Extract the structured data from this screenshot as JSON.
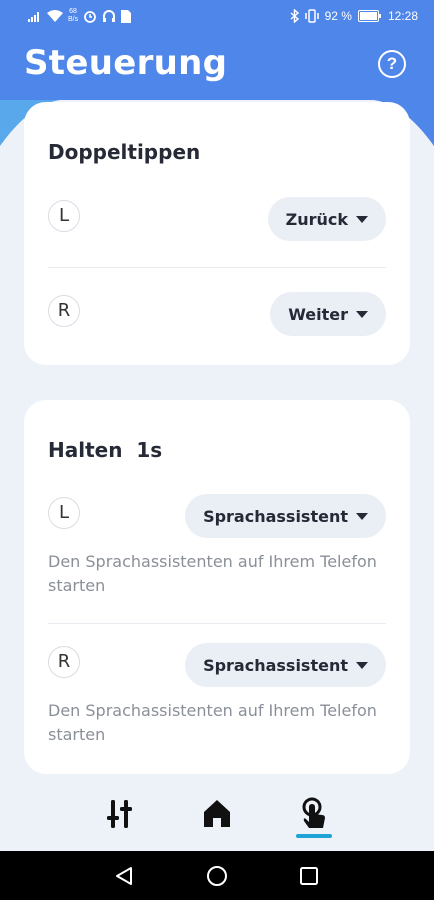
{
  "status_bar": {
    "speed_value": "68",
    "speed_unit": "B/s",
    "battery": "92 %",
    "time": "12:28"
  },
  "header": {
    "title": "Steuerung",
    "help_label": "?"
  },
  "double_tap": {
    "title": "Doppeltippen",
    "left": {
      "side": "L",
      "action": "Zurück"
    },
    "right": {
      "side": "R",
      "action": "Weiter"
    }
  },
  "hold": {
    "title": "Halten  1s",
    "left": {
      "side": "L",
      "action": "Sprachassistent",
      "description": "Den Sprachassistenten auf Ihrem Telefon starten"
    },
    "right": {
      "side": "R",
      "action": "Sprachassistent",
      "description": "Den Sprachassistenten auf Ihrem Telefon starten"
    }
  },
  "bottom_nav": {
    "items": [
      {
        "icon": "equalizer-icon",
        "active": false
      },
      {
        "icon": "home-icon",
        "active": false
      },
      {
        "icon": "touch-icon",
        "active": true
      }
    ],
    "accent_color": "#1fa2d5"
  },
  "colors": {
    "header": "#4f86ea",
    "background": "#edf2f8"
  }
}
